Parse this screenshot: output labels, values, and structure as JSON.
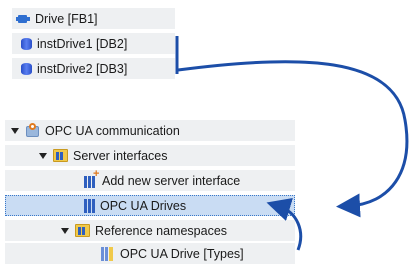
{
  "program_blocks": [
    {
      "label": "Drive [FB1]",
      "icon": "function-block-icon"
    },
    {
      "label": "instDrive1 [DB2]",
      "icon": "data-block-icon"
    },
    {
      "label": "instDrive2 [DB3]",
      "icon": "data-block-icon"
    }
  ],
  "tree": {
    "opc_ua_communication": "OPC UA communication",
    "server_interfaces": "Server interfaces",
    "add_new_server_interface": "Add new server interface",
    "opc_ua_drives": "OPC UA Drives",
    "reference_namespaces": "Reference namespaces",
    "opc_ua_drive_types": "OPC UA Drive [Types]"
  },
  "colors": {
    "arrow": "#1c4ea8",
    "selection": "#c9dcf3",
    "block_background": "#eef0f2"
  }
}
